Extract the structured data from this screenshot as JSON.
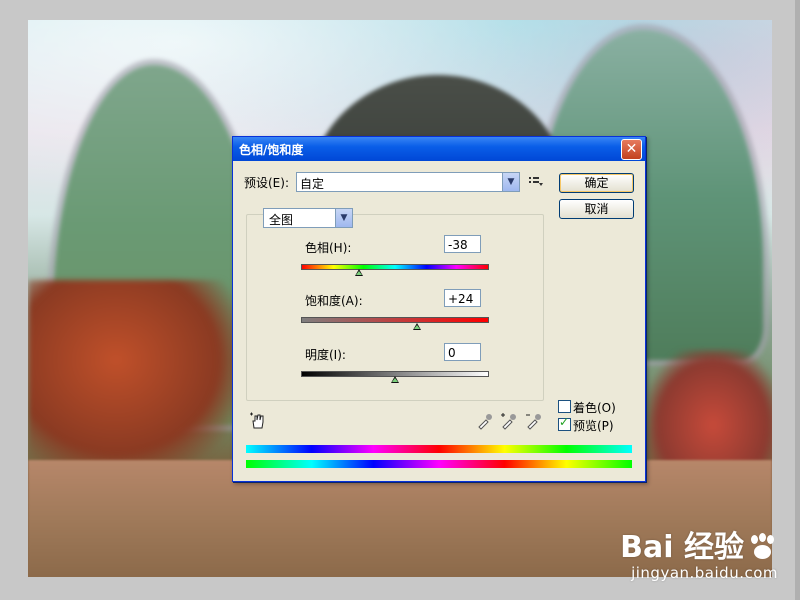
{
  "dialog": {
    "title": "色相/饱和度",
    "preset_label": "预设(E):",
    "preset_value": "自定",
    "ok_label": "确定",
    "cancel_label": "取消",
    "channel_value": "全图",
    "hue_label": "色相(H):",
    "hue_value": "-38",
    "saturation_label": "饱和度(A):",
    "saturation_value": "+24",
    "lightness_label": "明度(I):",
    "lightness_value": "0",
    "colorize_label": "着色(O)",
    "preview_label": "预览(P)",
    "colorize_checked": false,
    "preview_checked": true,
    "close_glyph": "✕"
  },
  "watermark": {
    "brand": "Bai  经验",
    "site": "jingyan.baidu.com"
  },
  "icons": [
    "close-icon",
    "dropdown-arrow-icon",
    "preset-options-icon",
    "hand-tool-icon",
    "eyedropper-icon",
    "eyedropper-plus-icon",
    "eyedropper-minus-icon",
    "paw-icon"
  ]
}
